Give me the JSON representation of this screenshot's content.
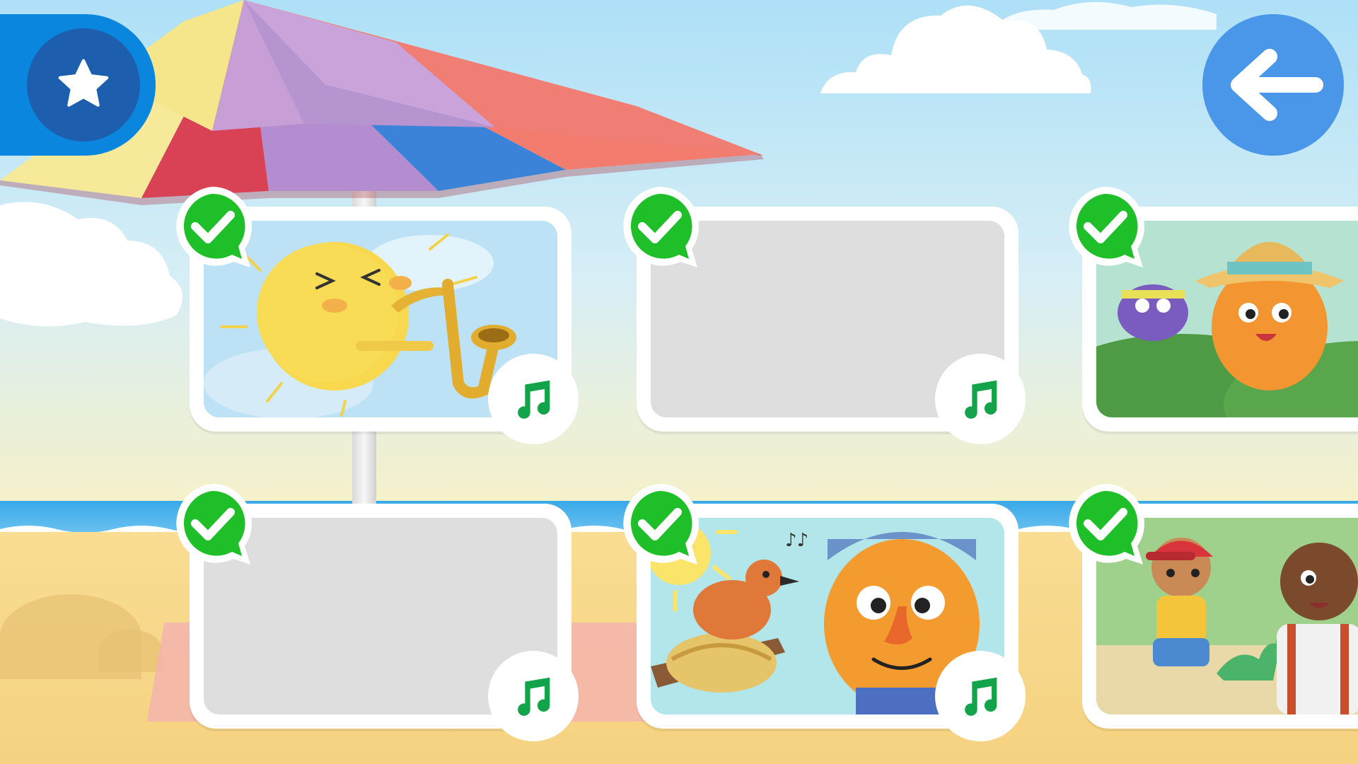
{
  "screen": {
    "title": ""
  },
  "toolbar": {
    "favorites_icon": "star-icon",
    "back_icon": "arrow-left-icon"
  },
  "colors": {
    "favorites_tab": "#0a86df",
    "favorites_circle": "#1d5fae",
    "back_button": "#4a97ea",
    "check_green": "#1fbf2a",
    "music_green": "#13a34a",
    "placeholder_gray": "#dedede"
  },
  "songs": [
    {
      "thumbnail": "sun-playing-saxophone",
      "loaded": true,
      "completed": true,
      "type_icon": "music-note-icon"
    },
    {
      "thumbnail": "placeholder",
      "loaded": false,
      "completed": true,
      "type_icon": "music-note-icon"
    },
    {
      "thumbnail": "orange-bug-with-hat",
      "loaded": true,
      "completed": true,
      "type_icon": "music-note-icon"
    },
    {
      "thumbnail": "placeholder",
      "loaded": false,
      "completed": true,
      "type_icon": "music-note-icon"
    },
    {
      "thumbnail": "bird-nest-and-face",
      "loaded": true,
      "completed": true,
      "type_icon": "music-note-icon"
    },
    {
      "thumbnail": "kids-with-dinosaur",
      "loaded": true,
      "completed": true,
      "type_icon": "music-note-icon"
    }
  ]
}
